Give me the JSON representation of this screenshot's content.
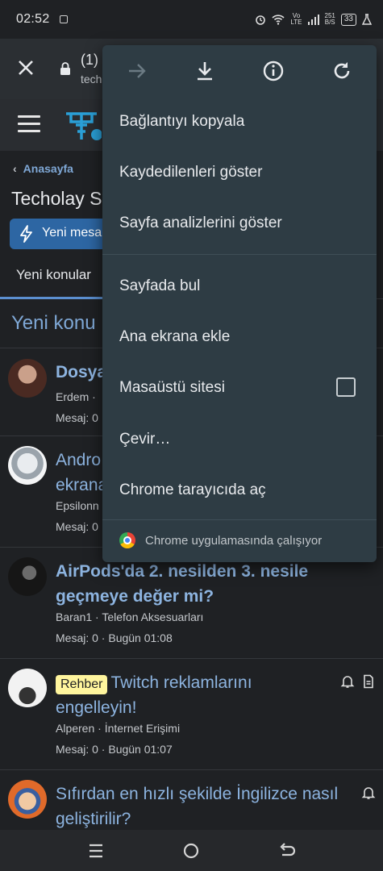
{
  "status_bar": {
    "time": "02:52",
    "net_label_top": "Vo",
    "net_label_bottom": "LTE",
    "speed_top": "251",
    "speed_bottom": "B/S",
    "battery": "33"
  },
  "toolbar": {
    "tab_title": "(1)",
    "url": "tech"
  },
  "page": {
    "breadcrumb": "Anasayfa",
    "title": "Techolay S",
    "new_button": "Yeni mesa",
    "tab_active": "Yeni konular",
    "section_title": "Yeni konu"
  },
  "threads": [
    {
      "title_line1": "Dosya",
      "title_line2": "",
      "meta_line1": "Erdem ·",
      "meta_line2": "Mesaj: 0"
    },
    {
      "title_line1": "Andro",
      "title_line2": "ekrana",
      "meta_line1": "Epsilonn",
      "meta_line2": "Mesaj: 0"
    },
    {
      "title_line1": "AirPods'da 2. nesilden 3. nesile",
      "title_line2": "geçmeye değer mi?",
      "meta_line1": "Baran1 · Telefon Aksesuarları",
      "meta_line2": "Mesaj: 0 · Bugün 01:08"
    },
    {
      "badge": "Rehber",
      "title_line1": "Twitch reklamlarını",
      "title_line2": "engelleyin!",
      "meta_line1": "Alperen · İnternet Erişimi",
      "meta_line2": "Mesaj: 0 · Bugün 01:07"
    },
    {
      "title_line1": "Sıfırdan en hızlı şekilde İngilizce nasıl",
      "title_line2": "geliştirilir?"
    }
  ],
  "menu": {
    "items": [
      "Bağlantıyı kopyala",
      "Kaydedilenleri göster",
      "Sayfa analizlerini göster",
      "Sayfada bul",
      "Ana ekrana ekle",
      "Masaüstü sitesi",
      "Çevir…",
      "Chrome tarayıcıda aç"
    ],
    "desktop_site_checked": false,
    "footer": "Chrome uygulamasında çalışıyor"
  },
  "colors": {
    "menu_bg": "#2e3c44",
    "link_blue": "#8db4e0",
    "accent_button": "#2d66a3",
    "badge_yellow": "#fff59d"
  },
  "icons": [
    "close-icon",
    "lock-icon",
    "forward-icon",
    "download-icon",
    "info-icon",
    "refresh-icon",
    "hamburger-icon",
    "bolt-icon",
    "bell-icon",
    "document-icon",
    "chrome-icon",
    "recents-icon",
    "home-icon",
    "back-icon"
  ]
}
